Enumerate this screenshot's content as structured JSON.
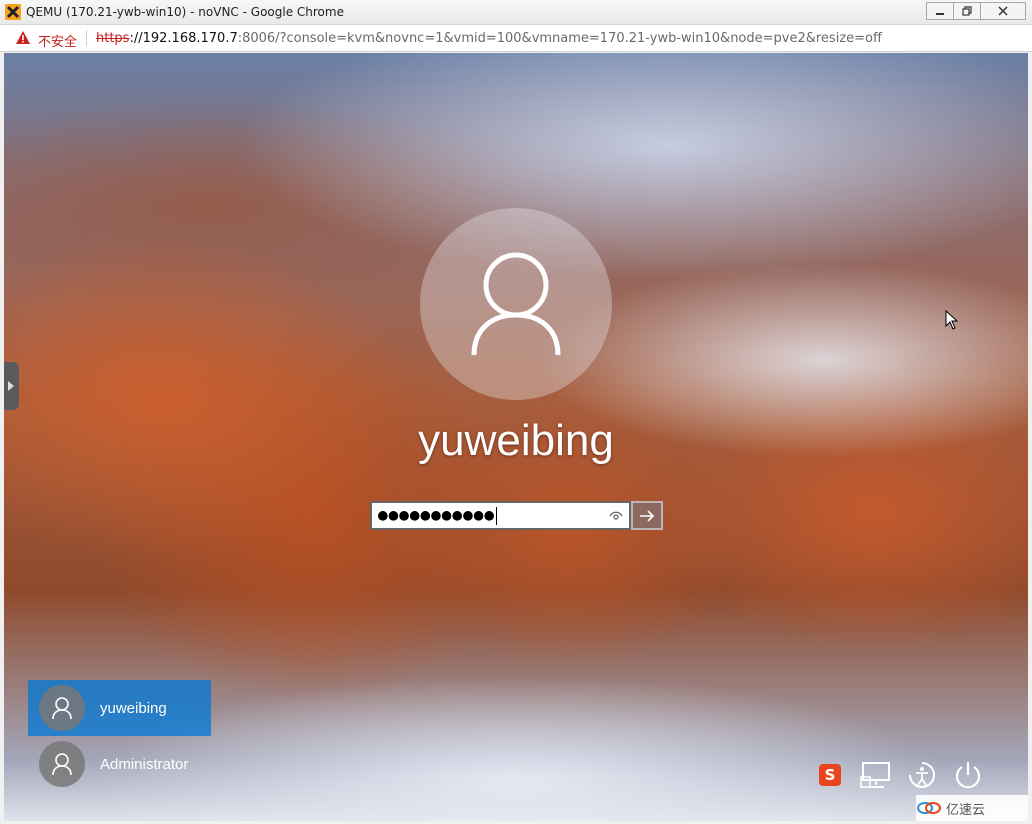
{
  "window": {
    "title": "QEMU (170.21-ywb-win10) - noVNC - Google Chrome",
    "controls": [
      "minimize",
      "maximize",
      "close"
    ]
  },
  "addressbar": {
    "security_label": "不安全",
    "url_scheme": "https",
    "url_host": "://192.168.170.7",
    "url_rest": ":8006/?console=kvm&novnc=1&vmid=100&vmname=170.21-ywb-win10&node=pve2&resize=off"
  },
  "lockscreen": {
    "current_user": "yuweibing",
    "password_value": "●●●●●●●●●●●",
    "users": [
      {
        "name": "yuweibing",
        "active": true
      },
      {
        "name": "Administrator",
        "active": false
      }
    ],
    "ime_glyph": "S",
    "tray_icons": [
      "ime-icon",
      "network-icon",
      "accessibility-icon",
      "power-icon"
    ]
  },
  "watermark": {
    "text": "亿速云"
  },
  "colors": {
    "selected_user_bg": "#0078d7",
    "insecure_red": "#c5221f"
  }
}
